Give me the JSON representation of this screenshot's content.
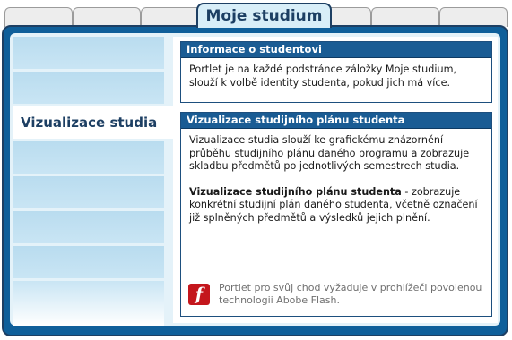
{
  "tabs": {
    "active_label": "Moje studium"
  },
  "menu": {
    "active_label": "Vizualizace studia"
  },
  "portlets": [
    {
      "title": "Informace o studentovi",
      "text": "Portlet je na každé podstránce záložky Moje studium, slouží k volbě identity studenta, pokud jich má více."
    },
    {
      "title": "Vizualizace studijního plánu studenta",
      "text1": "Vizualizace studia slouží ke grafickému znázornění průběhu studijního plánu daného programu a zobrazuje skladbu předmětů po jednotlivých semestrech studia.",
      "bold": "Vizualizace studijního plánu studenta",
      "text2": " - zobrazuje konkrétní studijní plán daného studenta, včetně označení již splněných předmětů a výsledků jejich plnění."
    }
  ],
  "flash_note": {
    "icon": "flash-player-icon",
    "text": "Portlet pro svůj chod vyžaduje v prohlížeči povolenou technologii Abobe Flash."
  }
}
